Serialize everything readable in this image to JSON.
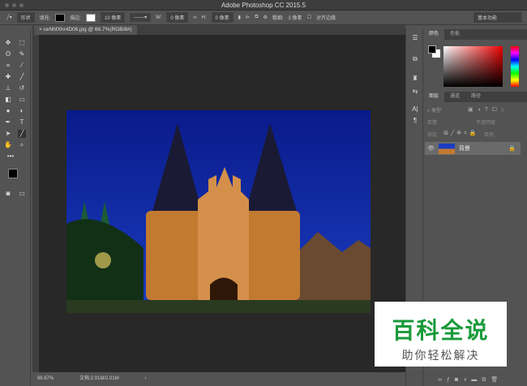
{
  "window": {
    "title": "Adobe Photoshop CC 2015.5"
  },
  "options": {
    "shape_mode": "形状",
    "fill_label": "填充:",
    "stroke_label": "描边:",
    "stroke_width": "10 像素",
    "w_label": "W:",
    "w_value": "0 像素",
    "h_label": "H:",
    "h_value": "0 像素",
    "radius_label": "粗细:",
    "radius_value": "3 像素",
    "align_edges": "对齐边缘",
    "workspace": "基本功能"
  },
  "document": {
    "tab": "ceNhfXhr4D06.jpg @ 66.7%(RGB/8#)"
  },
  "status": {
    "zoom": "66.67%",
    "doc_size": "文档:2.01M/2.01M"
  },
  "color_panel": {
    "tabs": [
      "颜色",
      "色板"
    ]
  },
  "layers_panel": {
    "tabs": [
      "图层",
      "通道",
      "路径"
    ],
    "filter": "类型",
    "blend_mode": "正常",
    "opacity_label": "不透明度:",
    "lock_label": "锁定:",
    "fill_label": "填充:",
    "layer_name": "背景"
  },
  "watermark": {
    "title": "百科全说",
    "subtitle": "助你轻松解决"
  }
}
